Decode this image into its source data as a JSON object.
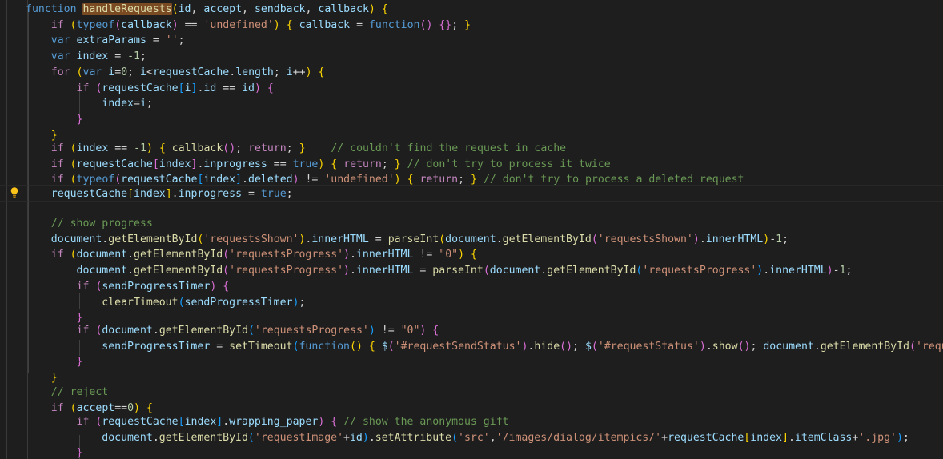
{
  "editor": {
    "theme": "Dark+ (VS Code)",
    "language": "javascript",
    "background_color": "#1e1e1e",
    "font_size_px": 13.2,
    "line_height_px": 19.7,
    "colors": {
      "background": "#1e1e1e",
      "foreground": "#d4d4d4",
      "keyword": "#569cd6",
      "control_keyword": "#c586c0",
      "function": "#dcdcaa",
      "variable": "#9cdcfe",
      "string": "#ce9178",
      "number": "#b5cea8",
      "comment": "#6a9955",
      "bracket_level_1": "#ffd700",
      "bracket_level_2": "#da70d6",
      "bracket_level_3": "#179fff",
      "selection_highlight": "#7a4a22",
      "indent_guide": "#404040",
      "current_line_border": "#282828",
      "gutter_rule": "#3a3a3a"
    }
  },
  "gutter": {
    "quick_fix_icon": "lightbulb-icon",
    "quick_fix_icon_glyph": "💡",
    "quick_fix_line_index": 10,
    "line_numbers_visible": false
  },
  "selection": {
    "highlighted_word": "handleRequests",
    "highlight_line_index": 0
  },
  "current_line": {
    "index": 10,
    "text": "requestCache[index].inprogress = true;"
  },
  "code": {
    "lines": [
      "function handleRequests(id, accept, sendback, callback) {",
      "    if (typeof(callback) == 'undefined') { callback = function() {}; }",
      "    var extraParams = '';",
      "    var index = -1;",
      "    for (var i=0; i<requestCache.length; i++) {",
      "        if (requestCache[i].id == id) {",
      "            index=i;",
      "        }",
      "    }",
      "    if (index == -1) { callback(); return; }    // couldn't find the request in cache",
      "    if (requestCache[index].inprogress == true) { return; } // don't try to process it twice",
      "    if (typeof(requestCache[index].deleted) != 'undefined') { return; } // don't try to process a deleted request",
      "    requestCache[index].inprogress = true;",
      "",
      "    // show progress",
      "    document.getElementById('requestsShown').innerHTML = parseInt(document.getElementById('requestsShown').innerHTML)-1;",
      "    if (document.getElementById('requestsProgress').innerHTML != \"0\") {",
      "        document.getElementById('requestsProgress').innerHTML = parseInt(document.getElementById('requestsProgress').innerHTML)-1;",
      "        if (sendProgressTimer) {",
      "            clearTimeout(sendProgressTimer);",
      "        }",
      "        if (document.getElementById('requestsProgress') != \"0\") {",
      "            sendProgressTimer = setTimeout(function() { $('#requestSendStatus').hide(); $('#requestStatus').show(); document.getElementById('request",
      "        }",
      "    }",
      "    // reject",
      "    if (accept==0) {",
      "        if (requestCache[index].wrapping_paper) { // show the anonymous gift",
      "            document.getElementById('requestImage'+id).setAttribute('src','/images/dialog/itempics/'+requestCache[index].itemClass+'.jpg');",
      "        }"
    ],
    "truncated_right_edge": true
  }
}
